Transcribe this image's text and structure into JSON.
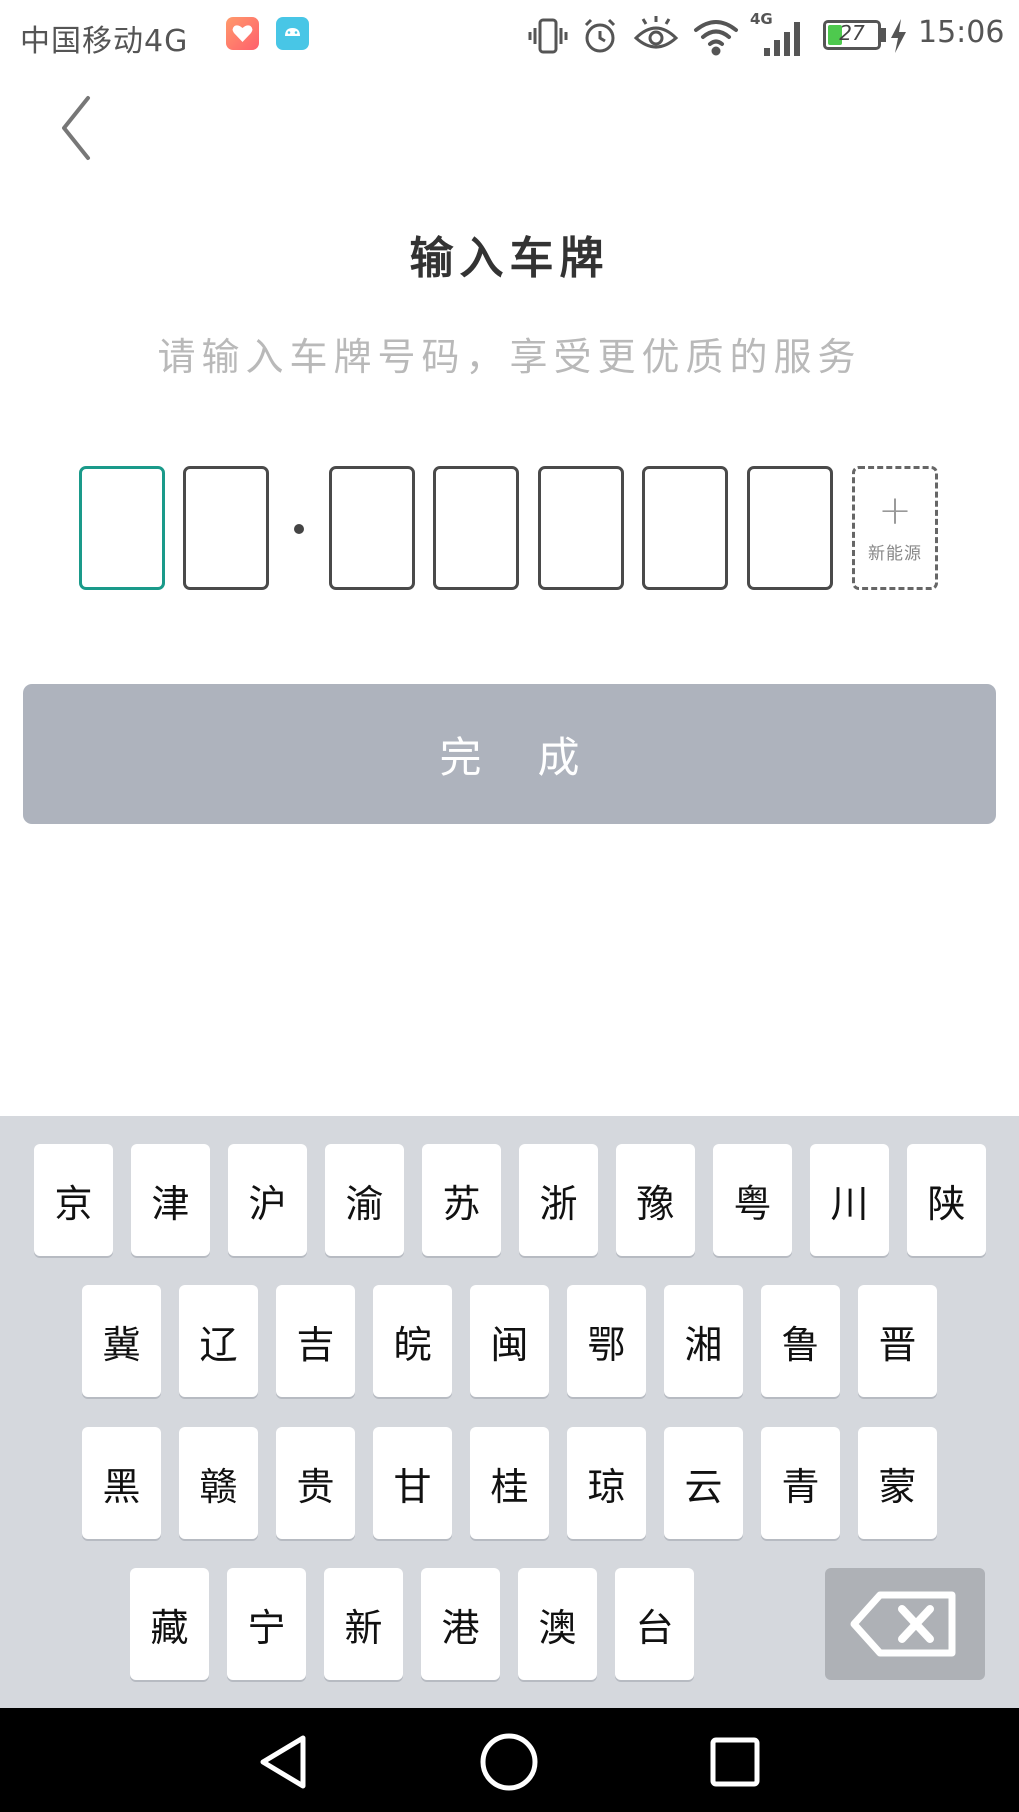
{
  "status_bar": {
    "carrier": "中国移动4G",
    "network_type": "4G",
    "battery_level": "27",
    "time": "15:06",
    "icons": [
      "health-app-icon",
      "android-app-icon",
      "vibrate-icon",
      "alarm-icon",
      "eye-icon",
      "wifi-icon",
      "signal-icon",
      "battery-icon",
      "charging-icon"
    ]
  },
  "header": {
    "back_icon": "chevron-left-icon",
    "title": "输入车牌",
    "subtitle": "请输入车牌号码，享受更优质的服务"
  },
  "plate_input": {
    "slots": [
      "",
      "",
      "",
      "",
      "",
      "",
      ""
    ],
    "active_index": 0,
    "new_energy_plus": "+",
    "new_energy_label": "新能源"
  },
  "done_button": {
    "label": "完成"
  },
  "keyboard": {
    "rows": [
      [
        "京",
        "津",
        "沪",
        "渝",
        "苏",
        "浙",
        "豫",
        "粤",
        "川",
        "陕"
      ],
      [
        "冀",
        "辽",
        "吉",
        "皖",
        "闽",
        "鄂",
        "湘",
        "鲁",
        "晋"
      ],
      [
        "黑",
        "赣",
        "贵",
        "甘",
        "桂",
        "琼",
        "云",
        "青",
        "蒙"
      ],
      [
        "藏",
        "宁",
        "新",
        "港",
        "澳",
        "台"
      ]
    ],
    "delete_icon": "backspace-icon"
  },
  "nav_bar": {
    "icons": [
      "back-triangle-icon",
      "home-circle-icon",
      "recents-square-icon"
    ]
  },
  "colors": {
    "accent": "#1a9a8a",
    "button_disabled": "#aeb3bd",
    "keyboard_bg": "#d5d8dd",
    "title": "#333333",
    "subtitle": "#b9b9b9"
  }
}
